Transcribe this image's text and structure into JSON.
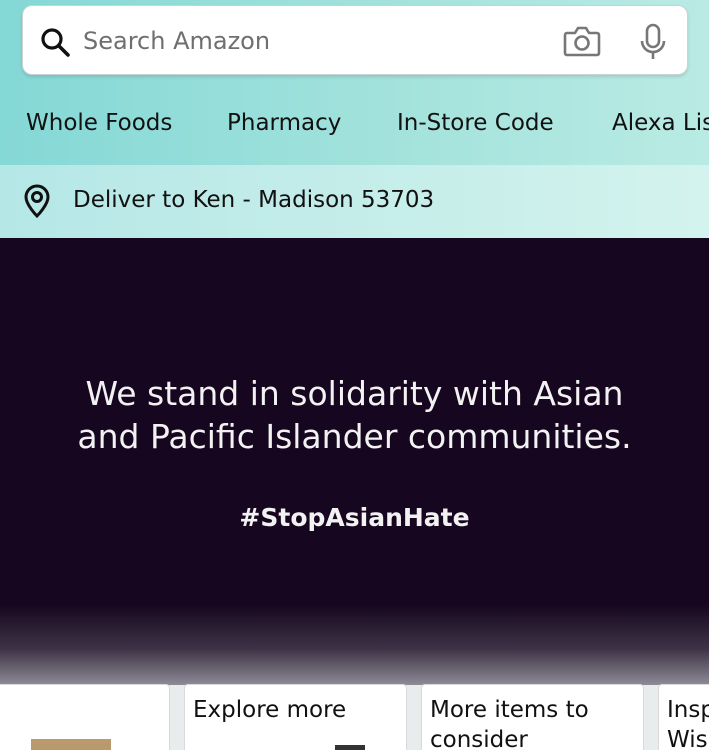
{
  "search": {
    "placeholder": "Search Amazon"
  },
  "nav": {
    "items": [
      "Whole Foods",
      "Pharmacy",
      "In-Store Code",
      "Alexa Lis"
    ]
  },
  "deliver": {
    "text": "Deliver to Ken - Madison 53703"
  },
  "hero": {
    "line1": "We stand in solidarity with Asian",
    "line2": "and Pacific Islander communities.",
    "hashtag": "#StopAsianHate"
  },
  "cards": [
    {
      "title": ""
    },
    {
      "title": "Explore more"
    },
    {
      "title_l1": "More items to",
      "title_l2": "consider"
    },
    {
      "title_l1": "Insp",
      "title_l2": "Wisl"
    }
  ],
  "colors": {
    "hero_bg": "#16061f",
    "header_teal": "#84d8d6"
  }
}
